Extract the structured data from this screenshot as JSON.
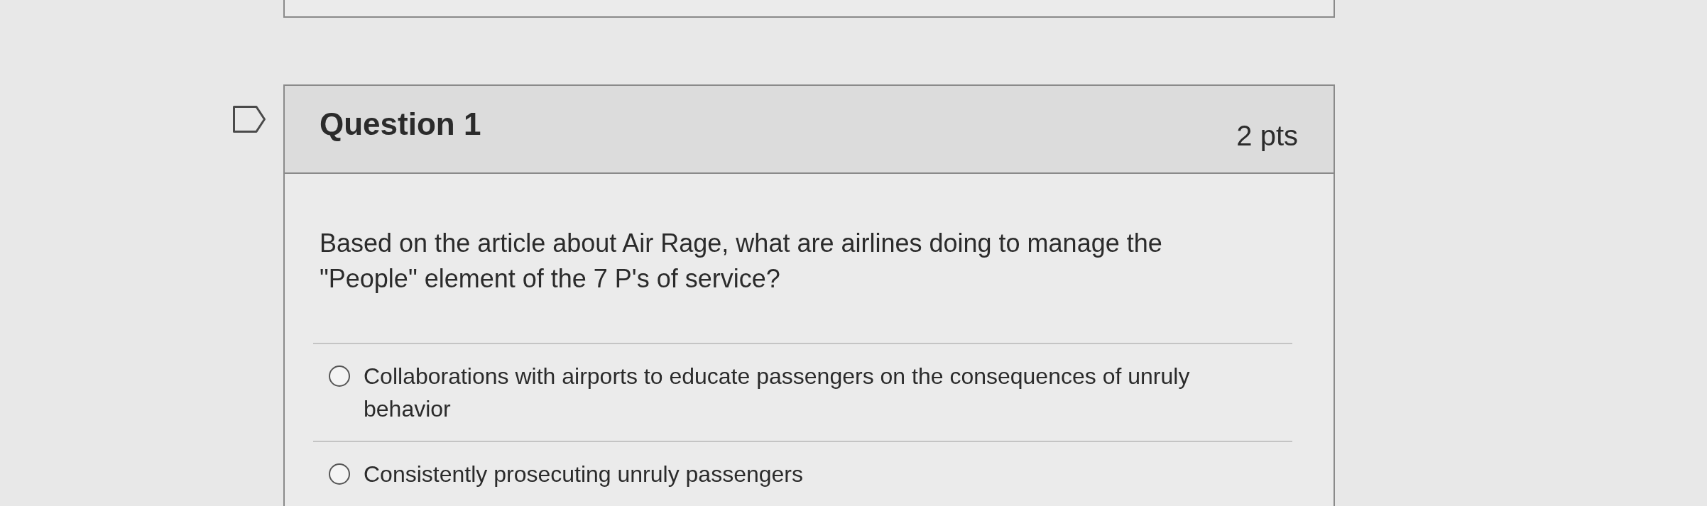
{
  "question": {
    "flagged": false,
    "title": "Question 1",
    "points": "2 pts",
    "text": "Based on the article about Air Rage, what are airlines doing to manage the \"People\" element of the 7 P's of service?",
    "answers": [
      {
        "label": "Collaborations with airports to educate passengers on the consequences of unruly behavior",
        "selected": false
      },
      {
        "label": "Consistently prosecuting unruly passengers",
        "selected": false
      }
    ]
  }
}
